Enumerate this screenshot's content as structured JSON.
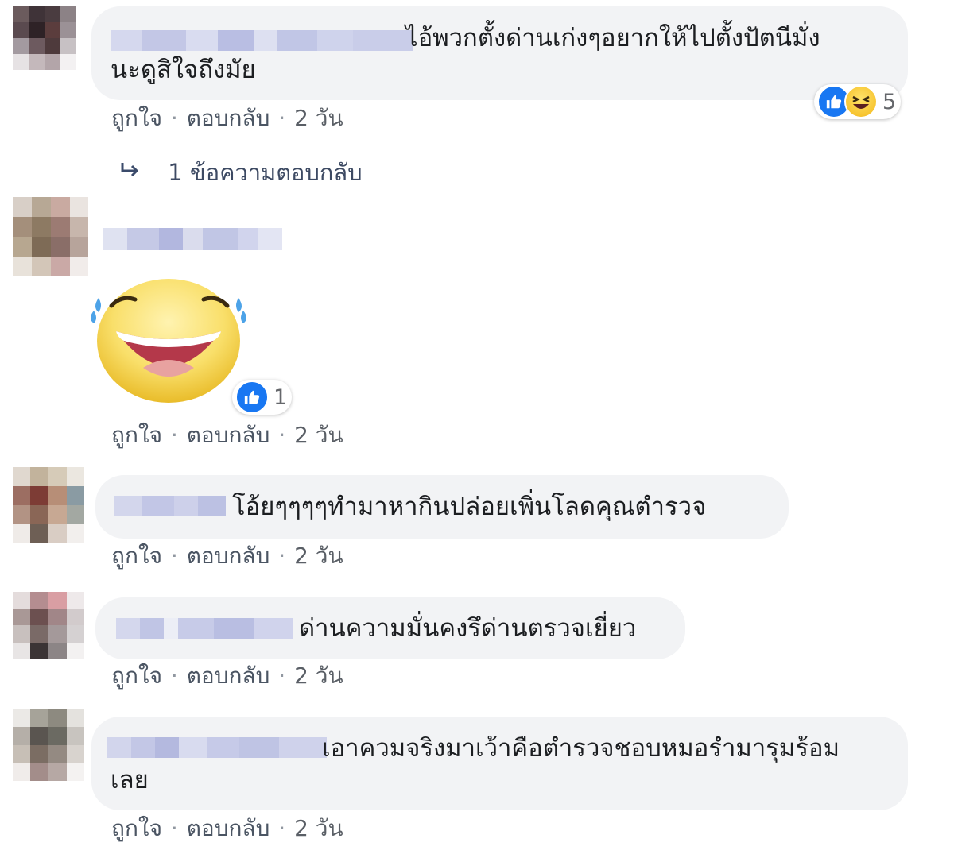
{
  "comments": [
    {
      "text_line1": "ไอ้พวกตั้งด่านเก่งๆอยากให้ไปตั้งปัตนีมั่ง",
      "text_line2": "นะดูสิใจถึงมัย",
      "reactions": {
        "icons": [
          "like-icon",
          "haha-icon"
        ],
        "count": "5"
      },
      "actions": {
        "like": "ถูกใจ",
        "reply": "ตอบกลับ",
        "time": "2 วัน",
        "sep": "·"
      },
      "replies_link": "1 ข้อความตอบกลับ"
    },
    {
      "sticker": "laughing-face-sticker",
      "reactions": {
        "icons": [
          "like-icon"
        ],
        "count": "1"
      },
      "actions": {
        "like": "ถูกใจ",
        "reply": "ตอบกลับ",
        "time": "2 วัน",
        "sep": "·"
      }
    },
    {
      "text_line1": "โอ้ยๆๆๆๆทำมาหากินปล่อยเพิ่นโลดคุณตำรวจ",
      "actions": {
        "like": "ถูกใจ",
        "reply": "ตอบกลับ",
        "time": "2 วัน",
        "sep": "·"
      }
    },
    {
      "text_line1": "ด่านความมั่นคงรึด่านตรวจเยี่ยว",
      "actions": {
        "like": "ถูกใจ",
        "reply": "ตอบกลับ",
        "time": "2 วัน",
        "sep": "·"
      }
    },
    {
      "text_line1": "เอาควมจริงมาเว้าคือตำรวจชอบหมอรำมารุมร้อม",
      "text_line2": "เลย",
      "actions": {
        "like": "ถูกใจ",
        "reply": "ตอบกลับ",
        "time": "2 วัน",
        "sep": "·"
      }
    }
  ],
  "colors": {
    "bubble": "#f2f3f5",
    "like_blue": "#1877f2",
    "meta_text": "#5a5f66",
    "name_blur": "#c9cde8"
  }
}
